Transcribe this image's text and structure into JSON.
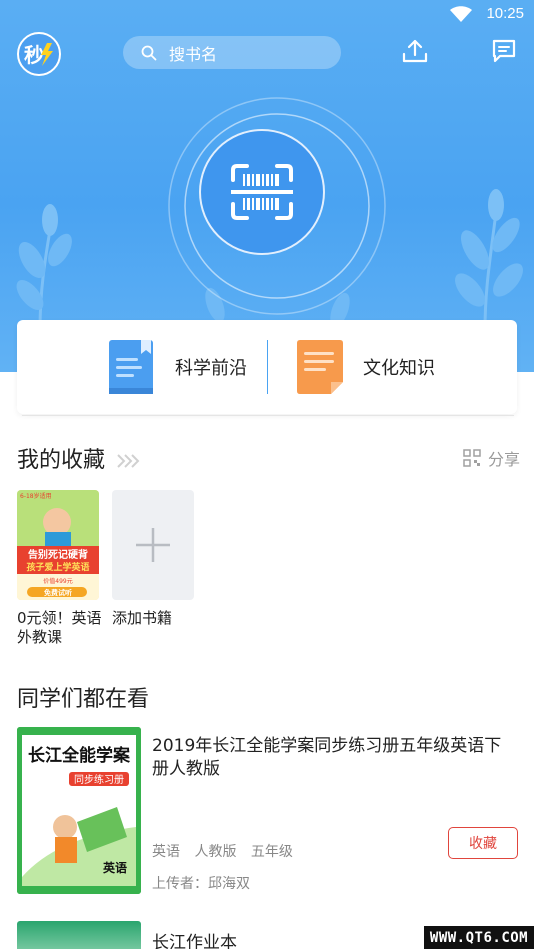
{
  "status_bar": {
    "time": "10:25"
  },
  "header": {
    "logo_text": "秒",
    "search_placeholder": "搜书名"
  },
  "categories": [
    {
      "label": "科学前沿",
      "icon": "blue-book-icon",
      "color": "#4b9ef0"
    },
    {
      "label": "文化知识",
      "icon": "orange-notes-icon",
      "color": "#f79a4c"
    }
  ],
  "favorites": {
    "title": "我的收藏",
    "share_label": "分享",
    "items": [
      {
        "title": "0元领！英语外教课",
        "cover": {
          "tag": "6-18岁适用",
          "headline1": "告别死记硬背",
          "headline2": "孩子爱上学英语",
          "price": "价值499元",
          "cta": "免费试听"
        }
      }
    ],
    "add_label": "添加书籍"
  },
  "popular": {
    "title": "同学们都在看",
    "items": [
      {
        "title": "2019年长江全能学案同步练习册五年级英语下册人教版",
        "tags": [
          "英语",
          "人教版",
          "五年级"
        ],
        "uploader": "上传者：邱海双",
        "collect_label": "收藏",
        "cover": {
          "brand": "长江全能学案",
          "subtitle": "同步练习册",
          "subject": "英语"
        }
      },
      {
        "title": "长江作业本"
      }
    ]
  },
  "watermark": "WWW.QT6.COM",
  "colors": {
    "primary": "#4aa3f2",
    "accent_red": "#e0453d",
    "text_gray": "#888888"
  }
}
